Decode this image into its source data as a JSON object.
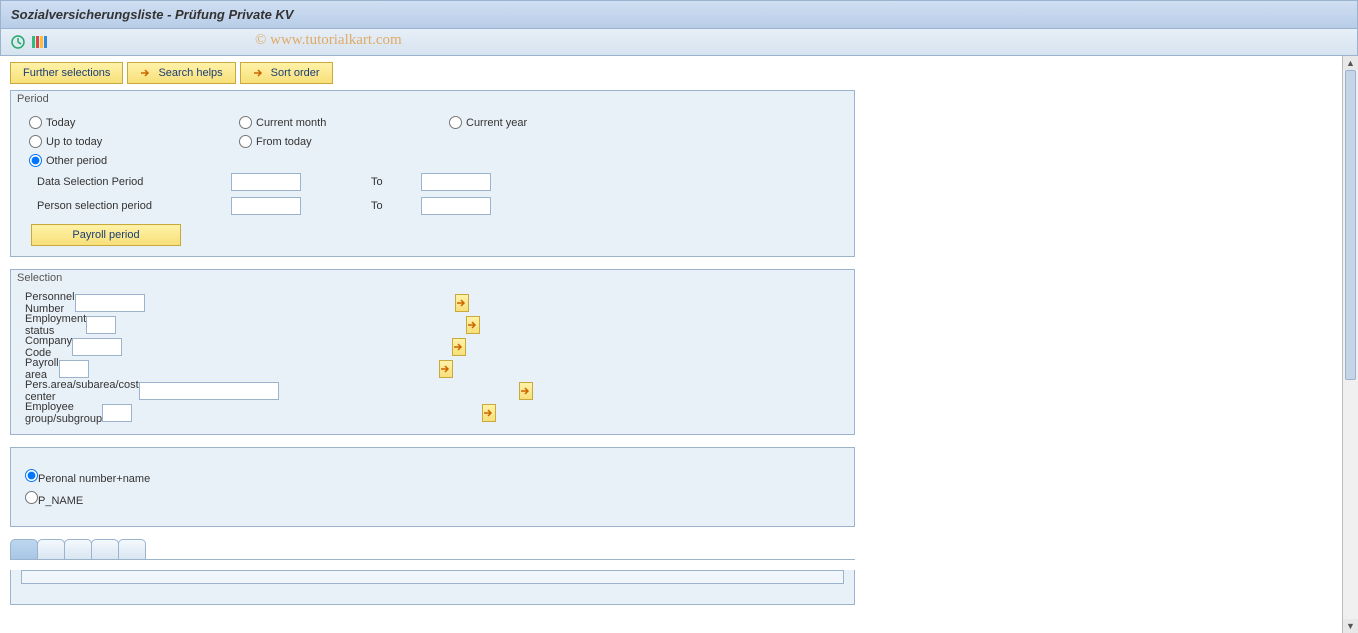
{
  "title": "Sozialversicherungsliste - Prüfung Private KV",
  "watermark": "© www.tutorialkart.com",
  "toolbar_buttons": {
    "further_selections": "Further selections",
    "search_helps": "Search helps",
    "sort_order": "Sort order"
  },
  "period": {
    "legend": "Period",
    "radios": {
      "today": "Today",
      "current_month": "Current month",
      "current_year": "Current year",
      "up_to_today": "Up to today",
      "from_today": "From today",
      "other_period": "Other period"
    },
    "selected": "other_period",
    "data_selection_label": "Data Selection Period",
    "person_selection_label": "Person selection period",
    "to_label": "To",
    "data_from": "",
    "data_to": "",
    "person_from": "",
    "person_to": "",
    "payroll_button": "Payroll period"
  },
  "selection": {
    "legend": "Selection",
    "rows": [
      {
        "label": "Personnel Number",
        "value": "",
        "width": "w70"
      },
      {
        "label": "Employment status",
        "value": "",
        "width": "w30"
      },
      {
        "label": "Company Code",
        "value": "",
        "width": "w50"
      },
      {
        "label": "Payroll area",
        "value": "",
        "width": "w30"
      },
      {
        "label": "Pers.area/subarea/cost center",
        "value": "",
        "width": "w140"
      },
      {
        "label": "Employee group/subgroup",
        "value": "",
        "width": "w30"
      }
    ]
  },
  "output_options": {
    "radios": {
      "personal_number_name": "Peronal number+name",
      "p_name": "P_NAME"
    },
    "selected": "personal_number_name"
  }
}
